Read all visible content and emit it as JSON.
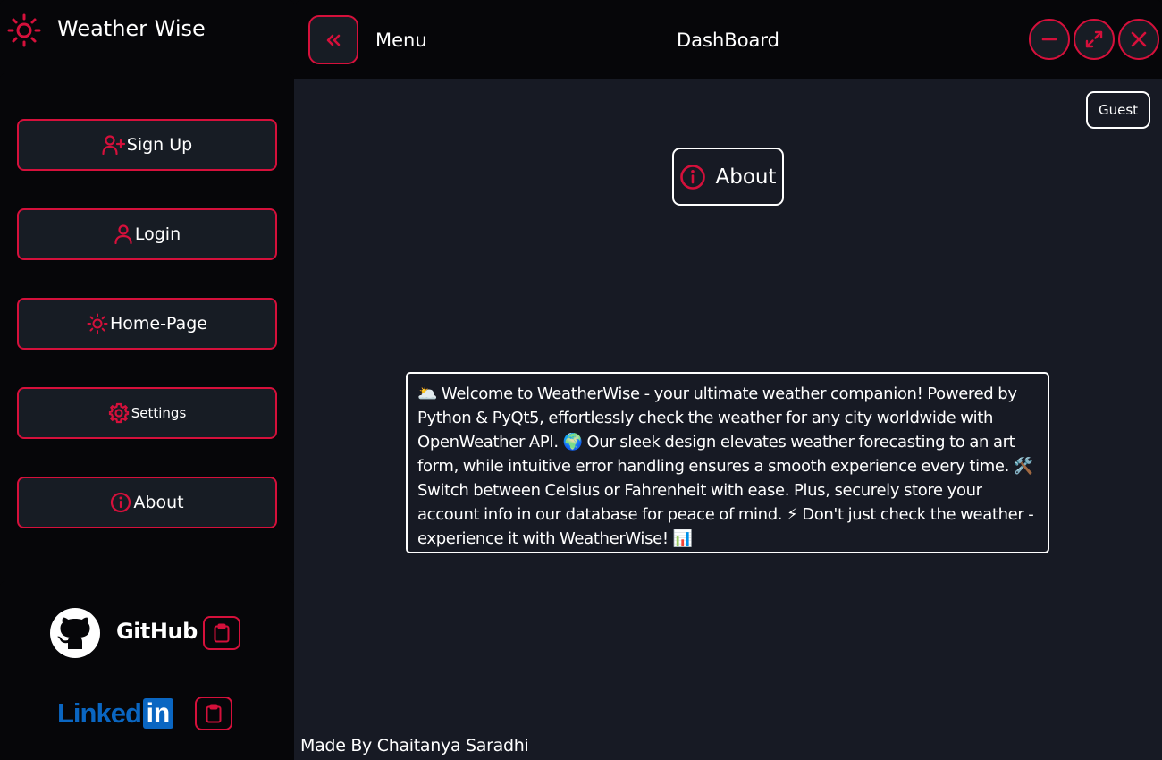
{
  "app": {
    "title": "Weather Wise"
  },
  "sidebar": {
    "items": [
      {
        "label": "Sign Up",
        "icon": "user-plus-icon"
      },
      {
        "label": "Login",
        "icon": "user-icon"
      },
      {
        "label": "Home-Page",
        "icon": "sun-icon"
      },
      {
        "label": "Settings",
        "icon": "gear-icon"
      },
      {
        "label": "About",
        "icon": "info-icon"
      }
    ]
  },
  "social": {
    "github_label": "GitHub",
    "linkedin_label": "Linked",
    "linkedin_box": "in"
  },
  "topbar": {
    "menu_label": "Menu",
    "title": "DashBoard"
  },
  "main": {
    "guest_label": "Guest",
    "heading": "About",
    "about_text": "🌥️ Welcome to WeatherWise - your ultimate weather companion! Powered by Python & PyQt5, effortlessly check the weather for any city worldwide with OpenWeather API. 🌍 Our sleek design elevates weather forecasting to an art form, while intuitive error handling ensures a smooth experience every time. 🛠️ Switch between Celsius or Fahrenheit with ease. Plus, securely store your account info in our database for peace of mind. ⚡ Don't just check the weather - experience it with WeatherWise! 📊",
    "footer": "Made By Chaitanya Saradhi"
  },
  "colors": {
    "accent": "#d5103b",
    "background": "#060609",
    "panel": "#171a24",
    "button": "#171c24",
    "linkedin": "#0a66c2"
  }
}
